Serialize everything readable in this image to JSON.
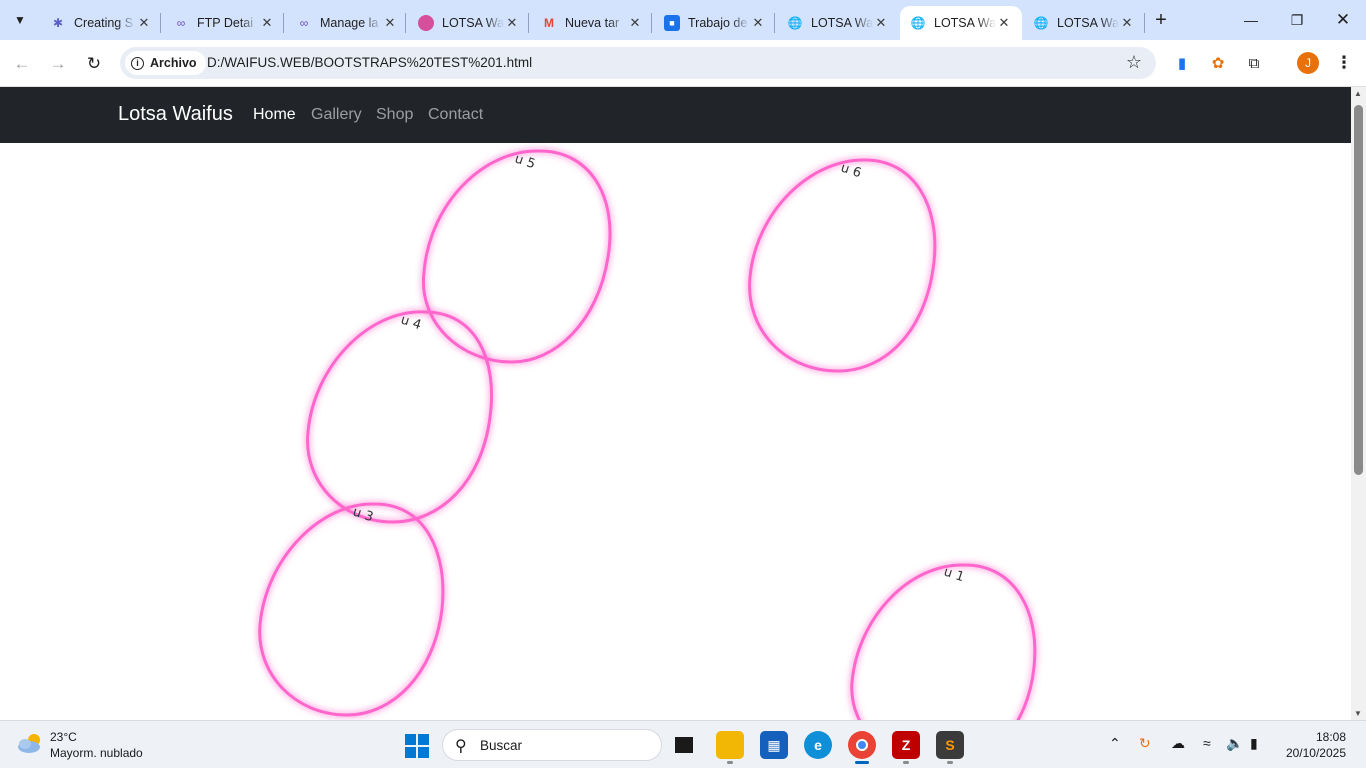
{
  "browser": {
    "tabs": [
      {
        "title": "Creating S",
        "icon": "gradient-logo-icon",
        "color": "#5b5fc7",
        "active": false
      },
      {
        "title": "FTP Detai",
        "icon": "infinity-icon",
        "color": "#6b4fbb",
        "active": false
      },
      {
        "title": "Manage la",
        "icon": "infinity-icon",
        "color": "#6b4fbb",
        "active": false
      },
      {
        "title": "LOTSA Wa",
        "icon": "avatar-favicon-icon",
        "color": "#d64f9a",
        "active": false
      },
      {
        "title": "Nueva tar",
        "icon": "gmail-icon",
        "color": "#ea4335",
        "active": false
      },
      {
        "title": "Trabajo de",
        "icon": "classroom-icon",
        "color": "#1a73e8",
        "active": false
      },
      {
        "title": "LOTSA Wa",
        "icon": "globe-icon",
        "color": "#5f6368",
        "active": false
      },
      {
        "title": "LOTSA Wa",
        "icon": "globe-icon",
        "color": "#5f6368",
        "active": true
      },
      {
        "title": "LOTSA Wa",
        "icon": "globe-icon",
        "color": "#5f6368",
        "active": false
      }
    ],
    "address": {
      "chip_label": "Archivo",
      "url": "D:/WAIFUS.WEB/BOOTSTRAPS%20TEST%201.html"
    },
    "profile_initial": "J"
  },
  "site": {
    "brand": "Lotsa Waifus",
    "nav": [
      {
        "label": "Home",
        "active": true
      },
      {
        "label": "Gallery",
        "active": false
      },
      {
        "label": "Shop",
        "active": false
      },
      {
        "label": "Contact",
        "active": false
      }
    ],
    "blob_color": "#ff66cc",
    "blobs": [
      {
        "label": "u 5"
      },
      {
        "label": "u 6"
      },
      {
        "label": "u 4"
      },
      {
        "label": "u 3"
      },
      {
        "label": "u 1"
      }
    ]
  },
  "taskbar": {
    "weather": {
      "temp": "23°C",
      "desc": "Mayorm. nublado"
    },
    "search_placeholder": "Buscar",
    "clock": {
      "time": "18:08",
      "date": "20/10/2025"
    }
  }
}
